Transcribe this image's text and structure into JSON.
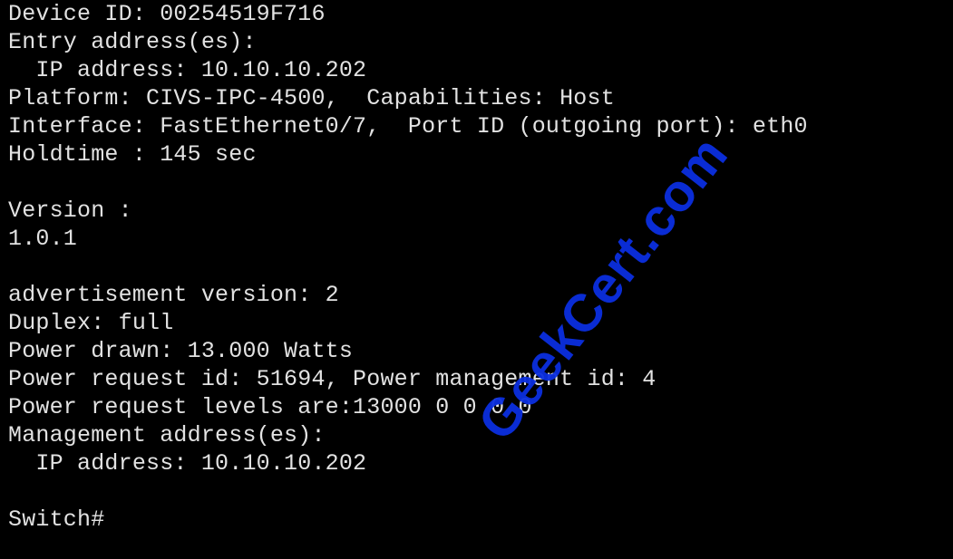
{
  "terminal": {
    "lines": [
      "Device ID: 00254519F716",
      "Entry address(es):",
      "  IP address: 10.10.10.202",
      "Platform: CIVS-IPC-4500,  Capabilities: Host",
      "Interface: FastEthernet0/7,  Port ID (outgoing port): eth0",
      "Holdtime : 145 sec",
      "",
      "Version :",
      "1.0.1",
      "",
      "advertisement version: 2",
      "Duplex: full",
      "Power drawn: 13.000 Watts",
      "Power request id: 51694, Power management id: 4",
      "Power request levels are:13000 0 0 0 0",
      "Management address(es):",
      "  IP address: 10.10.10.202",
      "",
      "Switch#"
    ],
    "text_color": "#e2e2e2",
    "background_color": "#000000"
  },
  "watermark": {
    "text": "GeekCert.com",
    "color": "#0b2fe0"
  }
}
